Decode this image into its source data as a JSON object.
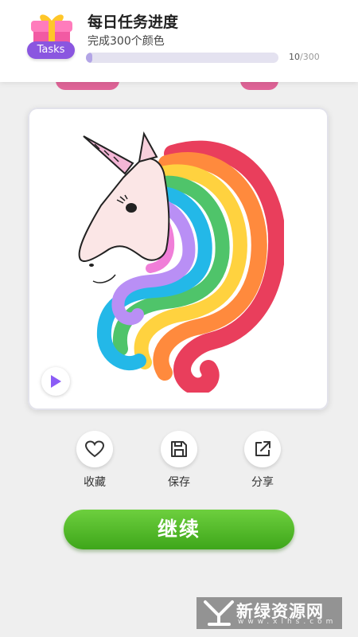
{
  "header": {
    "badge_label": "Tasks",
    "title": "每日任务进度",
    "subtitle": "完成300个颜色",
    "progress": {
      "current": "10",
      "separator": "/",
      "total": "300",
      "fraction": 0.0333
    }
  },
  "artwork": {
    "subject": "unicorn coloring page"
  },
  "play_button": {
    "icon": "play-icon",
    "color": "#8b5cf6"
  },
  "actions": [
    {
      "label": "收藏",
      "icon": "heart-icon"
    },
    {
      "label": "保存",
      "icon": "save-icon"
    },
    {
      "label": "分享",
      "icon": "share-icon"
    }
  ],
  "continue_button": {
    "label": "继续",
    "color": "#4db625"
  },
  "watermark": {
    "text": "新绿资源网",
    "url": "www.xlhs.com"
  }
}
